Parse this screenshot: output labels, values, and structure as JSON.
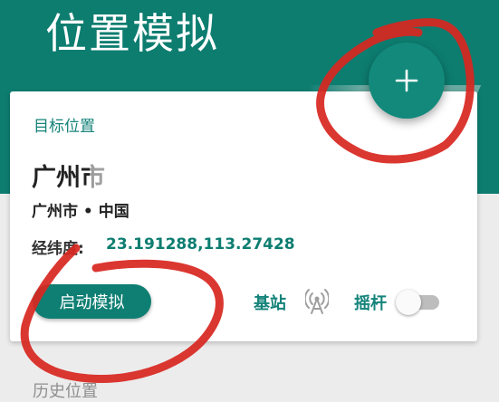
{
  "page": {
    "title": "位置模拟"
  },
  "fab": {
    "icon": "plus-icon"
  },
  "card": {
    "section_label": "目标位置",
    "address": "广州市",
    "region": "广州市 • 中国",
    "coord_label": "经纬度:",
    "coord_value": "23.191288,113.27428",
    "start_button": "启动模拟",
    "base_station_label": "基站",
    "base_station_icon": "antenna-icon",
    "joystick_label": "摇杆",
    "joystick_enabled": false
  },
  "history": {
    "label": "历史位置"
  },
  "colors": {
    "primary": "#0d7d70",
    "accent": "#12897b",
    "annotation": "#d8261f"
  }
}
